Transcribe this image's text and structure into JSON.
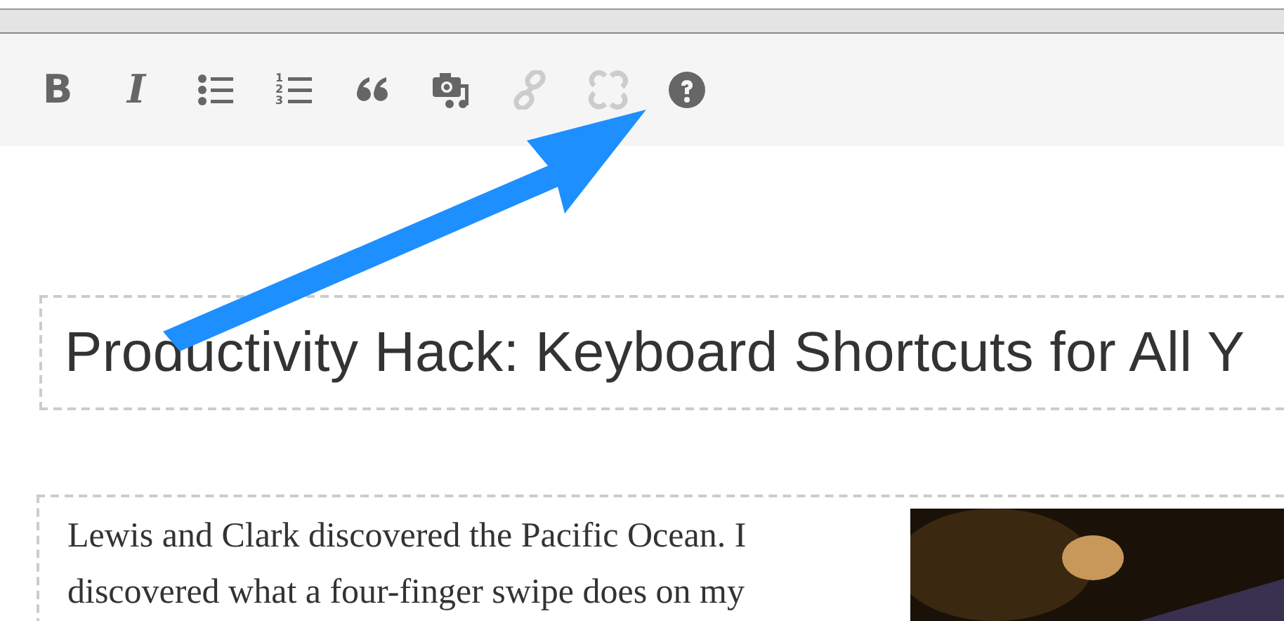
{
  "toolbar": {
    "tools": [
      {
        "kind": "bold",
        "label": "B",
        "disabled": false
      },
      {
        "kind": "italic",
        "label": "I",
        "disabled": false
      },
      {
        "kind": "bullets",
        "disabled": false
      },
      {
        "kind": "numbers",
        "digits": [
          "1",
          "2",
          "3"
        ],
        "disabled": false
      },
      {
        "kind": "quote",
        "disabled": false
      },
      {
        "kind": "media",
        "disabled": false
      },
      {
        "kind": "link",
        "disabled": true
      },
      {
        "kind": "unlink",
        "disabled": true
      },
      {
        "kind": "help",
        "disabled": false
      }
    ]
  },
  "title": {
    "value": "Productivity Hack: Keyboard Shortcuts for All Y"
  },
  "body": {
    "text": "Lewis and Clark discovered the Pacific Ocean. I discovered what a four-finger swipe does on my"
  }
}
